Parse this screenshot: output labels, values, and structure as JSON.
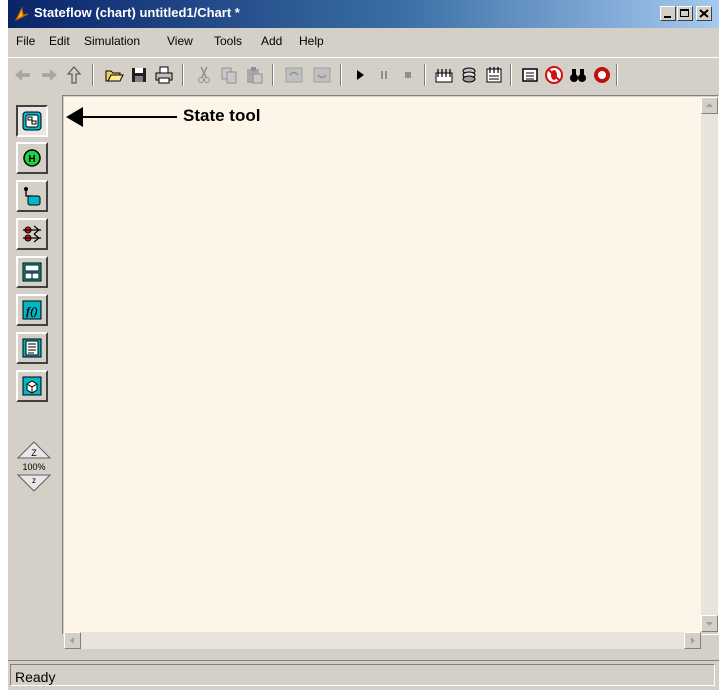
{
  "window": {
    "title": "Stateflow (chart) untitled1/Chart *",
    "title_icon": "stateflow-icon"
  },
  "menubar": {
    "items": [
      "File",
      "Edit",
      "Simulation",
      "View",
      "Tools",
      "Add",
      "Help"
    ]
  },
  "toolbar": {
    "buttons": [
      "back-icon",
      "forward-icon",
      "up-icon",
      "open-icon",
      "save-icon",
      "print-icon",
      "cut-icon",
      "copy-icon",
      "paste-icon",
      "undo-icon",
      "redo-icon",
      "start-icon",
      "pause-icon",
      "stop-icon",
      "build-icon",
      "rebuild-icon",
      "model-explorer-icon",
      "debugger-icon",
      "find-icon",
      "simulink-icon"
    ]
  },
  "palette": {
    "tools": [
      "state-tool-icon",
      "history-junction-icon",
      "default-transition-icon",
      "connective-junction-icon",
      "truth-table-icon",
      "graphical-function-icon",
      "embedded-matlab-icon",
      "box-tool-icon"
    ],
    "zoom_top_label": "Z",
    "zoom_value": "100%",
    "zoom_bottom_label": "z"
  },
  "callout": {
    "text": "State tool"
  },
  "status": {
    "text": "Ready"
  },
  "colors": {
    "titlebar_start": "#0a246a",
    "titlebar_end": "#a6caf0",
    "chrome": "#d4d0c8",
    "canvas": "#fdf6e8",
    "tool_icon_accent": "#00b8c8"
  }
}
